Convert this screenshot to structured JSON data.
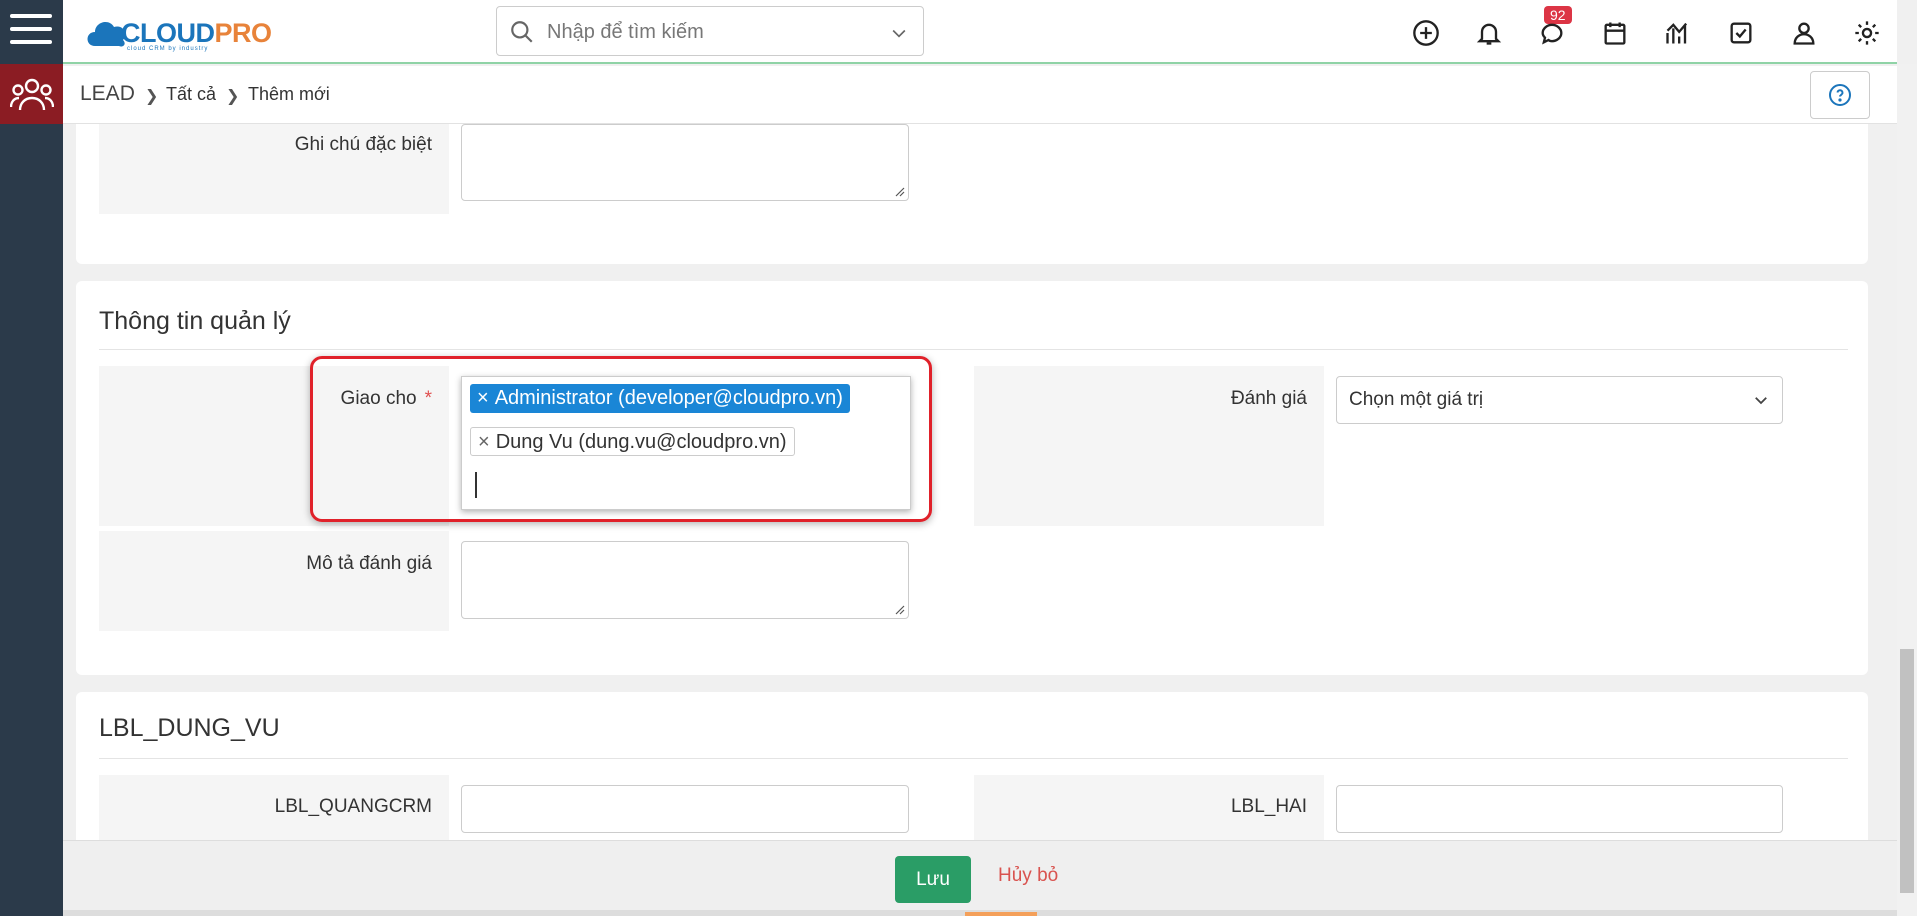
{
  "topbar": {
    "logo_main": "CLOUD",
    "logo_accent": "PRO",
    "logo_sub": "cloud CRM by industry",
    "search_placeholder": "Nhập để tìm kiếm",
    "notification_count": "92",
    "icons": [
      "plus-circle-icon",
      "bell-icon",
      "chat-icon",
      "calendar-icon",
      "chart-icon",
      "checkbox-icon",
      "user-icon",
      "gear-icon"
    ]
  },
  "breadcrumb": {
    "items": [
      "LEAD",
      "Tất cả",
      "Thêm mới"
    ]
  },
  "section_prev": {
    "special_note_label": "Ghi chú đặc biệt"
  },
  "section_manage": {
    "title": "Thông tin quản lý",
    "assign_label": "Giao cho",
    "required_mark": "*",
    "assignees": [
      {
        "label": "Administrator (developer@cloudpro.vn)",
        "selected": true
      },
      {
        "label": "Dung Vu (dung.vu@cloudpro.vn)",
        "selected": false
      }
    ],
    "rating_label": "Đánh giá",
    "rating_value": "Chọn một giá trị",
    "rating_desc_label": "Mô tả đánh giá"
  },
  "section_custom": {
    "title": "LBL_DUNG_VU",
    "field_left_label": "LBL_QUANGCRM",
    "field_right_label": "LBL_HAI"
  },
  "footer": {
    "save_label": "Lưu",
    "cancel_label": "Hủy bỏ"
  },
  "colors": {
    "rail": "#2b3a4a",
    "module_active": "#8b1c23",
    "accent_blue": "#1a86d6",
    "save_green": "#2a9d66",
    "highlight_red": "#e0212a"
  }
}
